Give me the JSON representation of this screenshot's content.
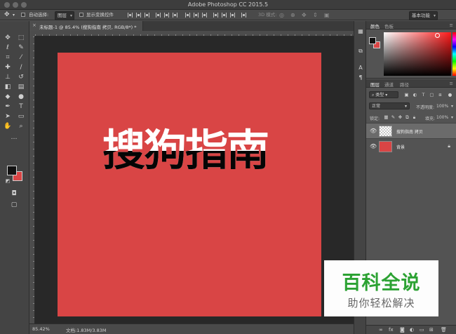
{
  "window": {
    "title": "Adobe Photoshop CC 2015.5"
  },
  "options_bar": {
    "auto_select_label": "自动选择:",
    "auto_select_value": "图层",
    "show_transform_label": "显示变换控件",
    "mode_3d_label": "3D 模式:",
    "workspace_value": "基本功能"
  },
  "document": {
    "tab_title": "未标题-1 @ 85.4% (搜狗指南 拷贝, RGB/8*) *",
    "canvas_text": "搜狗指南",
    "canvas_color": "#d94545",
    "zoom": "85.42%",
    "doc_info": "文档:1.83M/3.83M"
  },
  "color_panel": {
    "tabs": [
      "颜色",
      "色板"
    ],
    "foreground": "#121212",
    "background": "#d94545"
  },
  "layers_panel": {
    "tabs": [
      "图层",
      "通道",
      "路径"
    ],
    "filter_label": "类型",
    "blend_mode": "正常",
    "opacity_label": "不透明度:",
    "opacity_value": "100%",
    "lock_label": "锁定:",
    "fill_label": "填充:",
    "fill_value": "100%",
    "layers": [
      {
        "name": "搜狗指南 拷贝",
        "selected": true,
        "thumb": "transparent"
      },
      {
        "name": "背景",
        "selected": false,
        "thumb": "red",
        "locked": true
      }
    ]
  },
  "watermark": {
    "title": "百科全说",
    "subtitle": "助你轻松解决",
    "color": "#2ca233"
  }
}
